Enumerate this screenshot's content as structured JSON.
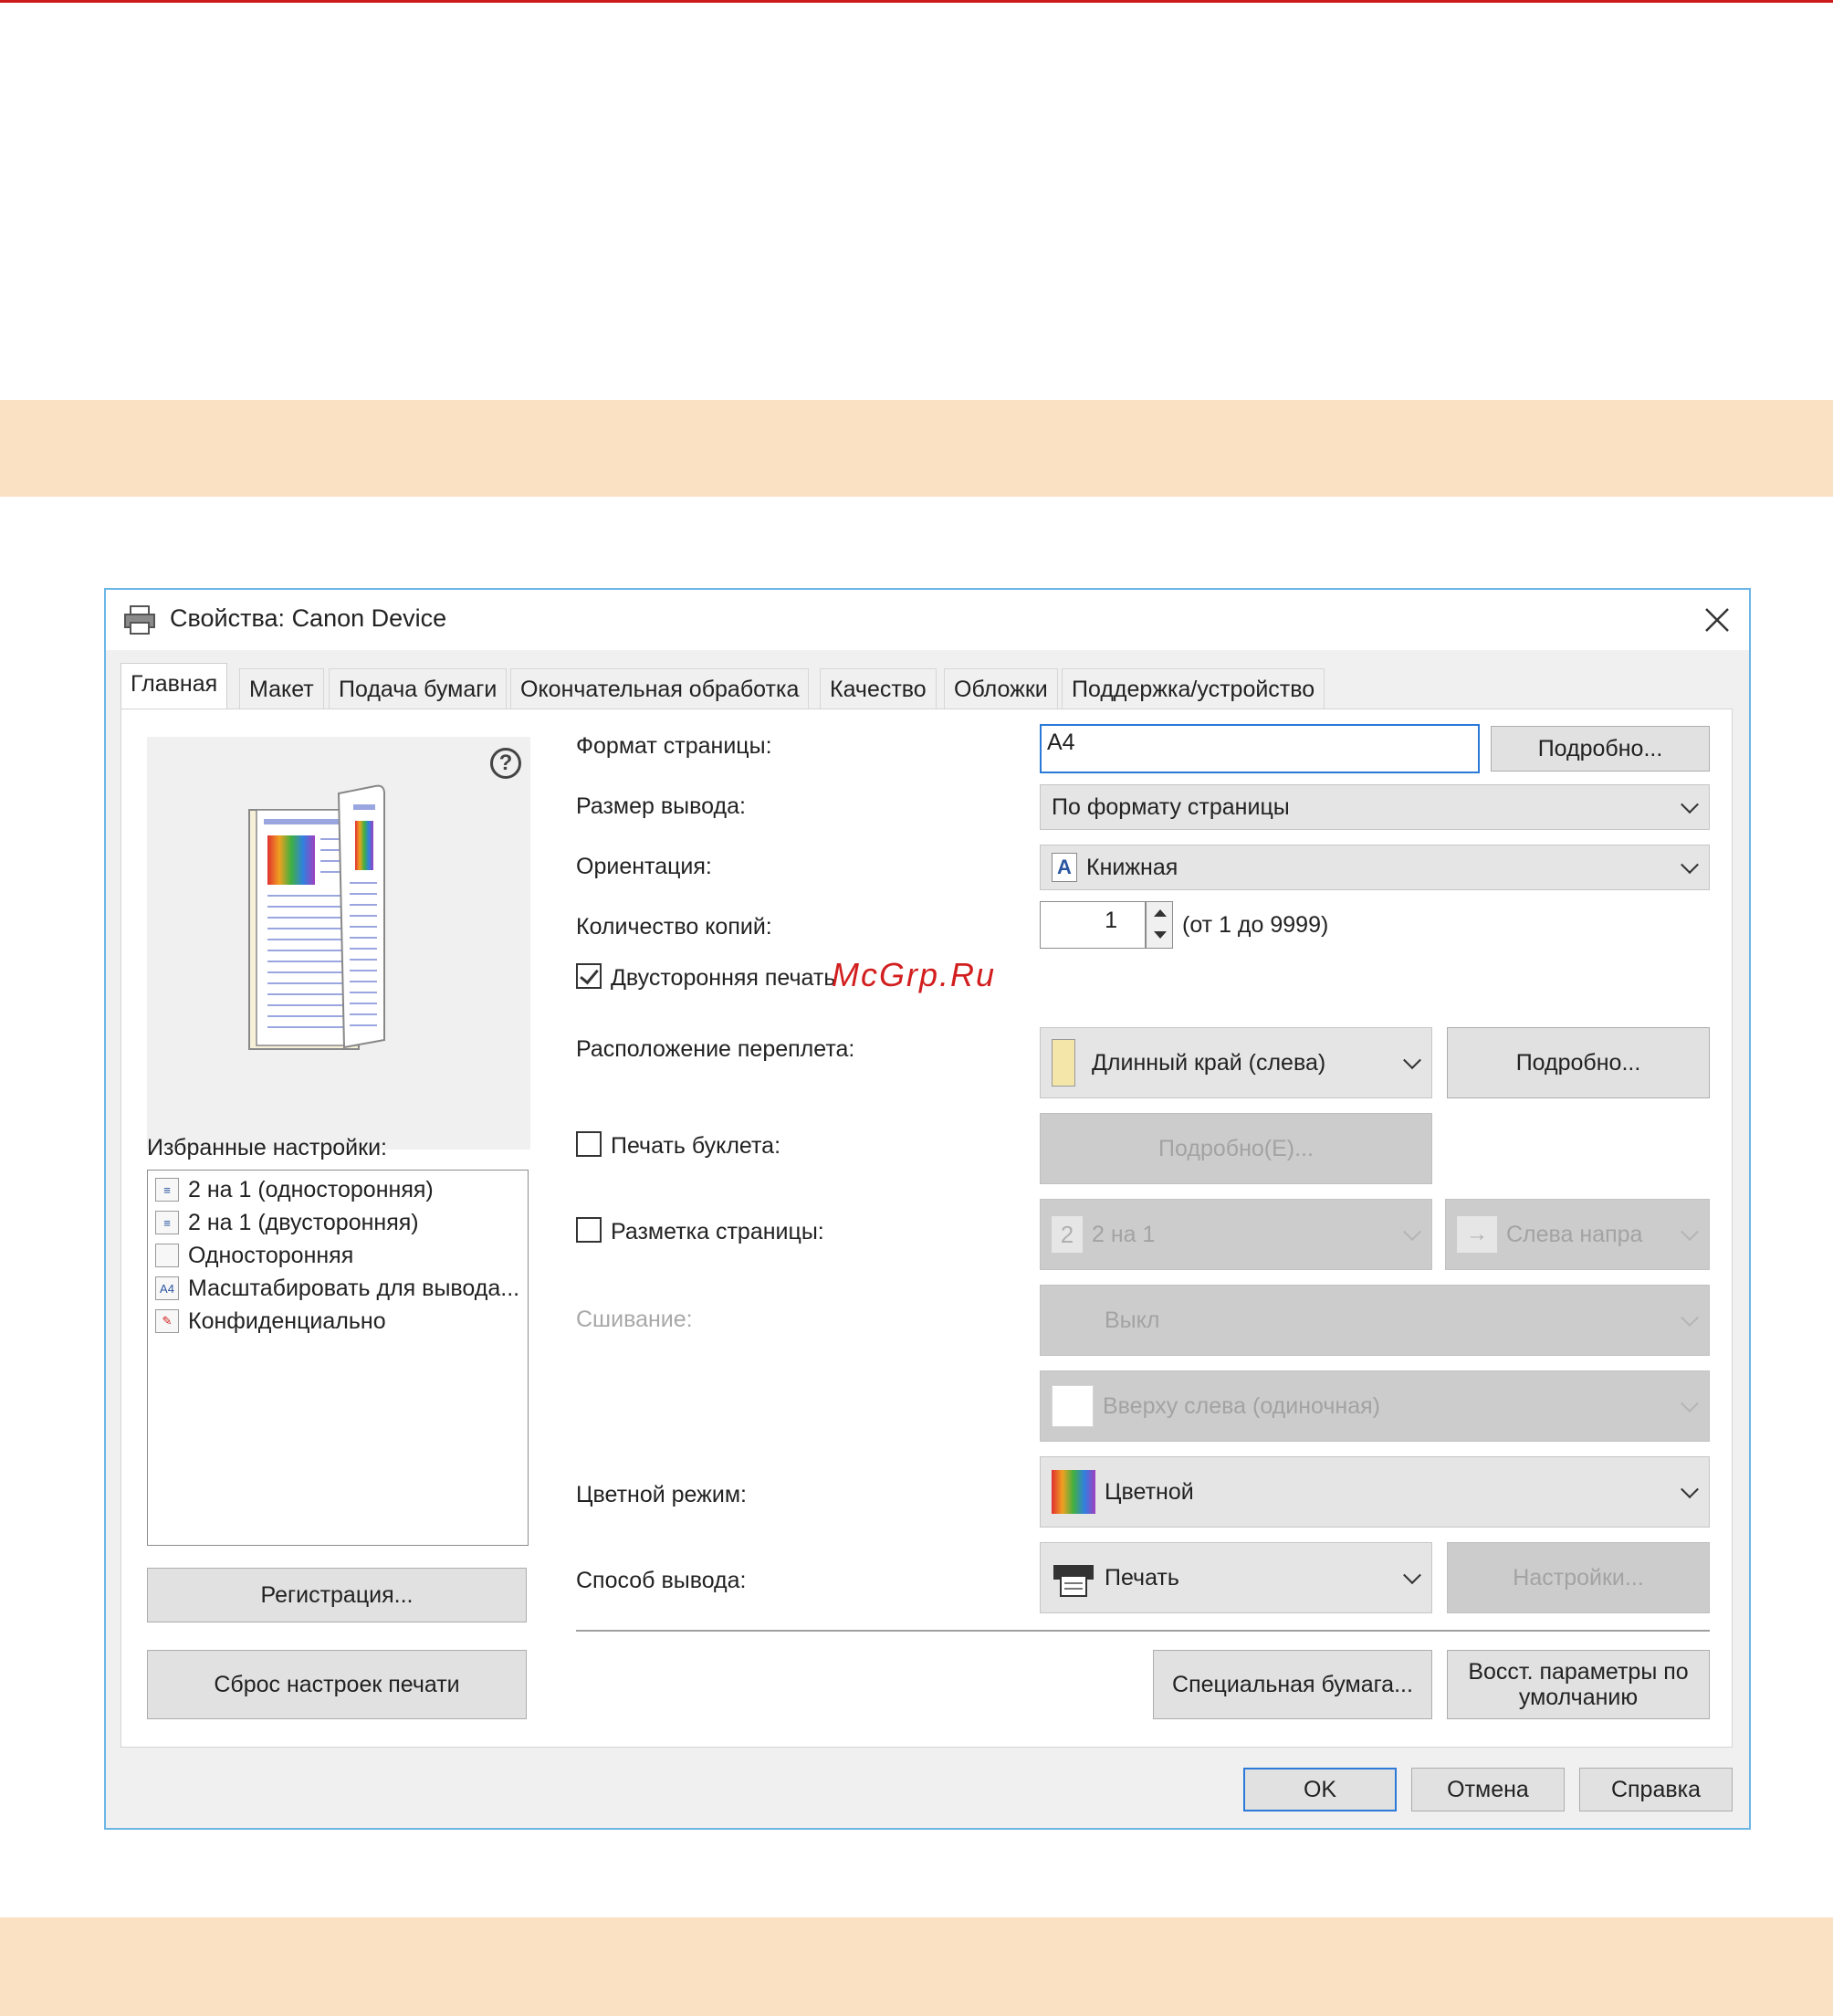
{
  "watermark": "McGrp.Ru",
  "dialog": {
    "title": "Свойства: Canon Device",
    "tabs": [
      "Главная",
      "Макет",
      "Подача бумаги",
      "Окончательная обработка",
      "Качество",
      "Обложки",
      "Поддержка/устройство"
    ],
    "help_glyph": "?",
    "favorites": {
      "label": "Избранные настройки:",
      "items": [
        "2 на 1 (односторонняя)",
        "2 на 1 (двусторонняя)",
        "Односторонняя",
        "Масштабировать для вывода...",
        "Конфиденциально"
      ],
      "icon_a4_text": "A4"
    },
    "register_button": "Регистрация...",
    "reset_button": "Сброс настроек печати",
    "page_size": {
      "label": "Формат страницы:",
      "value": "A4",
      "details_button": "Подробно..."
    },
    "output_size": {
      "label": "Размер вывода:",
      "value": "По формату страницы"
    },
    "orientation": {
      "label": "Ориентация:",
      "value": "Книжная",
      "icon_text": "A"
    },
    "copies": {
      "label": "Количество копий:",
      "value": "1",
      "range": "(от 1 до 9999)"
    },
    "duplex": {
      "label": "Двусторонняя печать",
      "checked": true
    },
    "binding": {
      "label": "Расположение переплета:",
      "value": "Длинный край (слева)",
      "details_button": "Подробно..."
    },
    "booklet": {
      "label": "Печать буклета:",
      "checked": false,
      "details_button": "Подробно(E)..."
    },
    "layout": {
      "label": "Разметка страницы:",
      "checked": false,
      "icon_text": "2",
      "value": "2 на 1",
      "order_value": "Слева напра"
    },
    "stapling": {
      "label": "Сшивание:",
      "value": "Выкл",
      "position_value": "Вверху слева (одиночная)"
    },
    "color_mode": {
      "label": "Цветной режим:",
      "value": "Цветной"
    },
    "output_method": {
      "label": "Способ вывода:",
      "value": "Печать",
      "settings_button": "Настройки..."
    },
    "special_paper_button": "Специальная бумага...",
    "restore_defaults_button": "Восст. параметры по умолчанию",
    "ok_button": "OK",
    "cancel_button": "Отмена",
    "help_button": "Справка"
  }
}
